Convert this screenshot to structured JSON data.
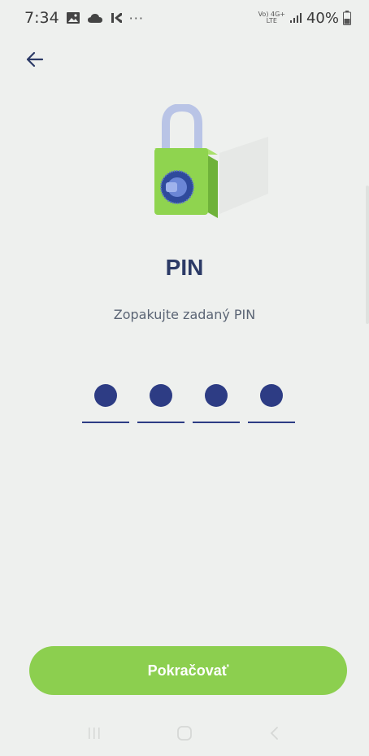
{
  "status_bar": {
    "time": "7:34",
    "notification_icons": [
      "gallery-icon",
      "cloud-icon",
      "k-icon"
    ],
    "overflow": "···",
    "network_top": "Vo) 4G+",
    "network_bottom": "LTE",
    "battery_percent": "40%"
  },
  "header": {
    "back_icon": "arrow-left-icon"
  },
  "main": {
    "title": "PIN",
    "subtitle": "Zopakujte zadaný PIN",
    "pin_length": 4,
    "pin_filled": 4
  },
  "actions": {
    "continue_label": "Pokračovať"
  },
  "colors": {
    "background": "#eef0ee",
    "title": "#2c3a66",
    "pin_accent": "#2d3c84",
    "button": "#8ccf4f",
    "lock_body": "#8fd44f"
  },
  "nav_bar": {
    "items": [
      "recent-apps-icon",
      "home-icon",
      "back-nav-icon"
    ]
  }
}
